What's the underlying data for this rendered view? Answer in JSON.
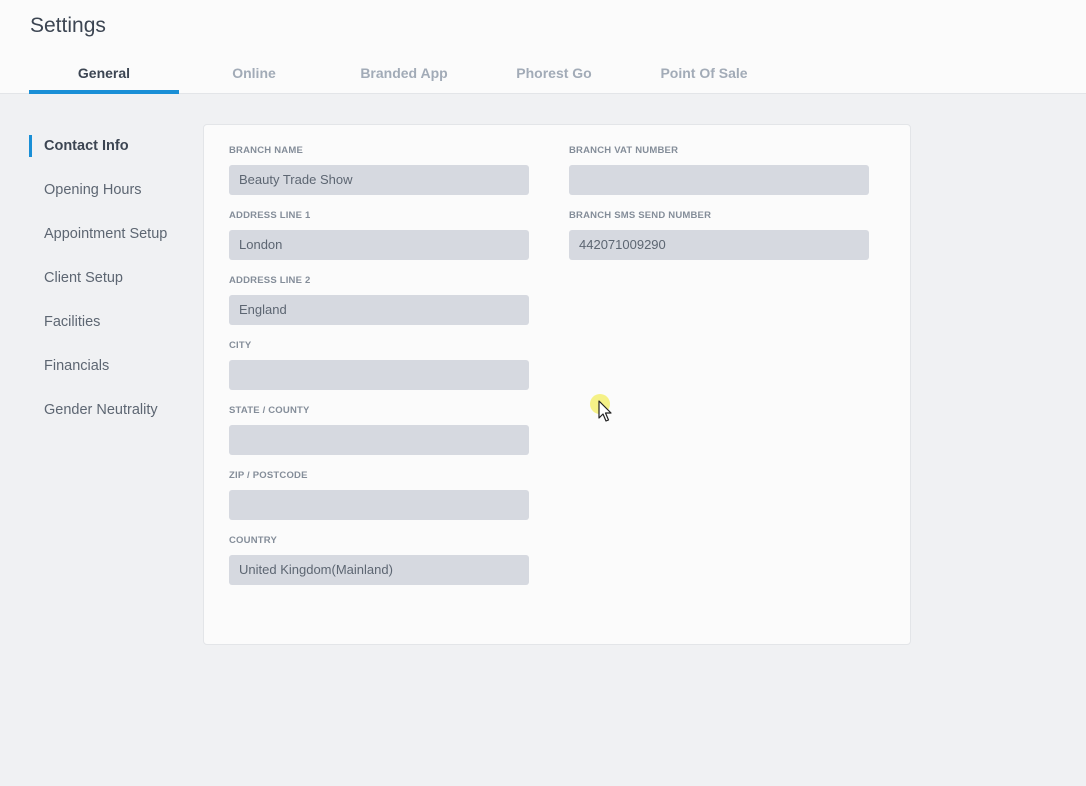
{
  "header": {
    "title": "Settings",
    "tabs": [
      {
        "label": "General",
        "active": true
      },
      {
        "label": "Online"
      },
      {
        "label": "Branded App"
      },
      {
        "label": "Phorest Go"
      },
      {
        "label": "Point Of Sale"
      }
    ]
  },
  "sidebar": {
    "items": [
      {
        "label": "Contact Info",
        "active": true
      },
      {
        "label": "Opening Hours"
      },
      {
        "label": "Appointment Setup"
      },
      {
        "label": "Client Setup"
      },
      {
        "label": "Facilities"
      },
      {
        "label": "Financials"
      },
      {
        "label": "Gender Neutrality"
      }
    ]
  },
  "form": {
    "left": [
      {
        "label": "BRANCH NAME",
        "value": "Beauty Trade Show"
      },
      {
        "label": "ADDRESS LINE 1",
        "value": "London"
      },
      {
        "label": "ADDRESS LINE 2",
        "value": "England"
      },
      {
        "label": "CITY",
        "value": ""
      },
      {
        "label": "STATE / COUNTY",
        "value": ""
      },
      {
        "label": "ZIP / POSTCODE",
        "value": ""
      },
      {
        "label": "COUNTRY",
        "value": "United Kingdom(Mainland)"
      }
    ],
    "right": [
      {
        "label": "BRANCH VAT NUMBER",
        "value": ""
      },
      {
        "label": "BRANCH SMS SEND NUMBER",
        "value": "442071009290"
      }
    ]
  },
  "colors": {
    "accent": "#1a8fd6",
    "input_bg": "#d6d9e0",
    "cursor_highlight": "#f4f07a"
  }
}
